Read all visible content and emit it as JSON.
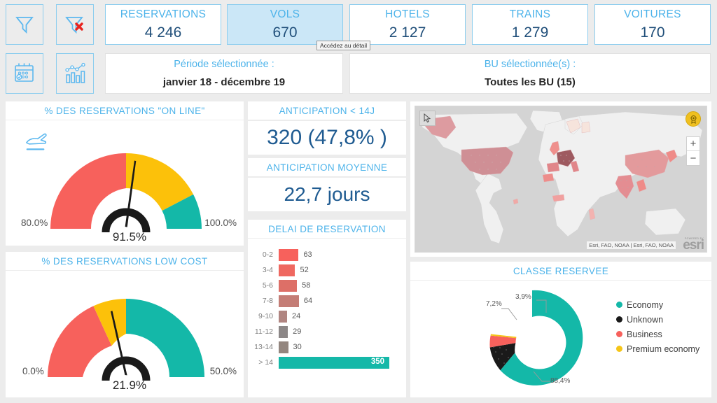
{
  "toolbar": {
    "buttons": [
      {
        "name": "filter-icon",
        "label": "Filtre"
      },
      {
        "name": "filter-clear-icon",
        "label": "Effacer le filtre"
      },
      {
        "name": "calendar-icon",
        "label": "Période"
      },
      {
        "name": "chart-icon",
        "label": "Graphiques"
      }
    ]
  },
  "kpis": [
    {
      "label": "RESERVATIONS",
      "value": "4 246",
      "selected": false
    },
    {
      "label": "VOLS",
      "value": "670",
      "selected": true
    },
    {
      "label": "HOTELS",
      "value": "2 127",
      "selected": false
    },
    {
      "label": "TRAINS",
      "value": "1 279",
      "selected": false
    },
    {
      "label": "VOITURES",
      "value": "170",
      "selected": false
    }
  ],
  "tooltip": {
    "text": "Accédez au détail"
  },
  "period": {
    "label": "Période sélectionnée :",
    "value": "janvier 18 - décembre 19"
  },
  "bu": {
    "label": "BU sélectionnée(s) :",
    "value": "Toutes les BU (15)"
  },
  "anticipation": {
    "short_title": "ANTICIPATION < 14J",
    "short_value": "320 (47,8% )",
    "avg_title": "ANTICIPATION MOYENNE",
    "avg_value": "22,7 jours"
  },
  "gauge_online": {
    "title": "% DES RESERVATIONS \"ON LINE\"",
    "icon": "airplane-icon",
    "min_label": "80.0%",
    "max_label": "100.0%",
    "value_label": "91.5%"
  },
  "gauge_lowcost": {
    "title": "% DES RESERVATIONS LOW COST",
    "min_label": "0.0%",
    "max_label": "50.0%",
    "value_label": "21.9%"
  },
  "delai": {
    "title": "DELAI DE RESERVATION"
  },
  "map": {
    "attribution": "Esri, FAO, NOAA | Esri, FAO, NOAA",
    "powered_by": "POWERED BY",
    "brand": "esri",
    "zoom_in": "+",
    "zoom_out": "−",
    "cursor_icon": "pointer-icon",
    "badge_icon": "award-icon"
  },
  "donut": {
    "title": "CLASSE RESERVEE"
  },
  "colors": {
    "accent_blue": "#4cb3ea",
    "value_blue": "#1f4e79",
    "red": "#f7615c",
    "yellow": "#fcc10a",
    "teal": "#14b8a8",
    "black": "#1a1a1a",
    "selected_bg": "#cbe7f7",
    "page_bg": "#ececec"
  },
  "chart_data": [
    {
      "type": "bar",
      "title": "DELAI DE RESERVATION",
      "orientation": "horizontal",
      "categories": [
        "0-2",
        "3-4",
        "5-6",
        "7-8",
        "9-10",
        "11-12",
        "13-14",
        "> 14"
      ],
      "values": [
        63,
        52,
        58,
        64,
        24,
        29,
        30,
        350
      ],
      "bar_colors": [
        "#f7615c",
        "#ef6860",
        "#dd6f67",
        "#c47d76",
        "#b08581",
        "#8c8787",
        "#93867f",
        "#14b8a8"
      ],
      "xlabel": "",
      "ylabel": "",
      "xlim": [
        0,
        350
      ],
      "grid": false
    },
    {
      "type": "pie",
      "subtype": "donut",
      "title": "CLASSE RESERVEE",
      "categories": [
        "Economy",
        "Unknown",
        "Business",
        "Premium economy"
      ],
      "values": [
        88.4,
        7.2,
        3.9,
        0.5
      ],
      "labels": [
        "88,4%",
        "7,2%",
        "3,9%",
        ""
      ],
      "colors": [
        "#14b8a8",
        "#1a1a1a",
        "#f7615c",
        "#f5c518"
      ],
      "legend_position": "right"
    },
    {
      "type": "gauge",
      "title": "% DES RESERVATIONS \"ON LINE\"",
      "min": 80.0,
      "max": 100.0,
      "value": 91.5,
      "bands": [
        {
          "from": 80.0,
          "to": 90.0,
          "color": "#f7615c"
        },
        {
          "from": 90.0,
          "to": 97.0,
          "color": "#fcc10a"
        },
        {
          "from": 97.0,
          "to": 100.0,
          "color": "#14b8a8"
        }
      ]
    },
    {
      "type": "gauge",
      "title": "% DES RESERVATIONS LOW COST",
      "min": 0.0,
      "max": 50.0,
      "value": 21.9,
      "bands": [
        {
          "from": 0.0,
          "to": 20.0,
          "color": "#f7615c"
        },
        {
          "from": 20.0,
          "to": 25.0,
          "color": "#fcc10a"
        },
        {
          "from": 25.0,
          "to": 50.0,
          "color": "#14b8a8"
        }
      ]
    }
  ]
}
